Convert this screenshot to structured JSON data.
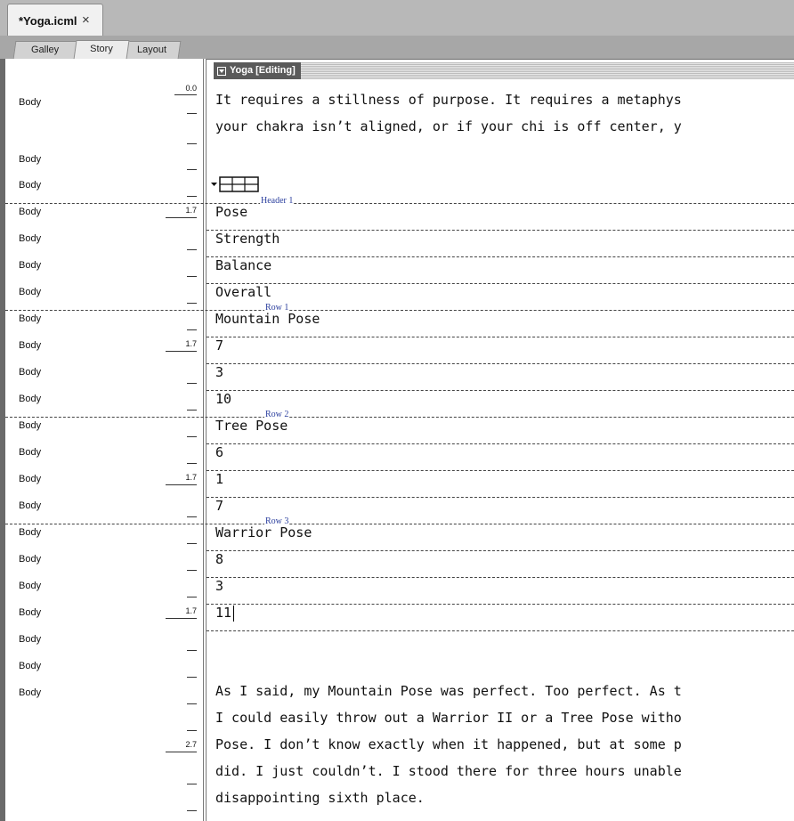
{
  "document_tab": {
    "title": "*Yoga.icml",
    "close_glyph": "×"
  },
  "view_tabs": [
    {
      "label": "Galley",
      "active": false
    },
    {
      "label": "Story",
      "active": true
    },
    {
      "label": "Layout",
      "active": false
    }
  ],
  "story_header": {
    "label": "Yoga [Editing]"
  },
  "depth_values": [
    "0.0",
    "1.7",
    "1.7",
    "1.7",
    "1.7",
    "2.7"
  ],
  "style_labels": [
    "Body",
    "Body",
    "Body",
    "Body",
    "Body",
    "Body",
    "Body",
    "Body",
    "Body",
    "Body",
    "Body",
    "Body",
    "Body",
    "Body",
    "Body",
    "Body",
    "Body",
    "Body",
    "Body",
    "Body",
    "Body",
    "Body"
  ],
  "paragraph1": [
    "It requires a stillness of purpose. It requires a metaphys",
    "your chakra isn’t aligned, or if your chi is off center, y"
  ],
  "table": {
    "row_labels": [
      "Header 1",
      "Row 1",
      "Row 2",
      "Row 3"
    ],
    "cells": [
      "Pose",
      "Strength",
      "Balance",
      "Overall",
      "Mountain Pose",
      "7",
      "3",
      "10",
      "Tree Pose",
      "6",
      "1",
      "7",
      "Warrior Pose",
      "8",
      "3",
      "11"
    ]
  },
  "paragraph2": [
    "As I said, my Mountain Pose was perfect. Too perfect. As t",
    "I could easily throw out a Warrior II or a Tree Pose witho",
    "Pose. I don’t know exactly when it happened, but at some p",
    "did. I just couldn’t. I stood there for three hours unable",
    "disappointing sixth place."
  ]
}
